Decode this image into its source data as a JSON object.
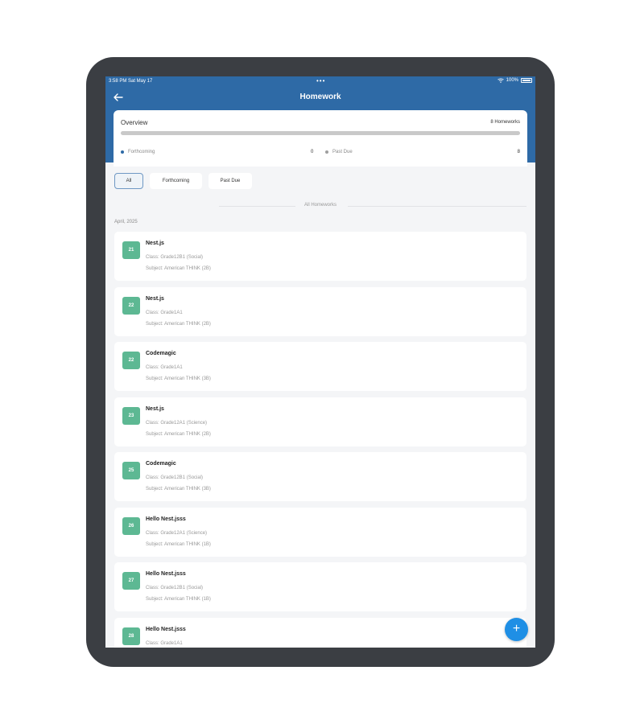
{
  "status_bar": {
    "time": "3:58 PM  Sat May 17",
    "dots": "•••",
    "battery": "100%"
  },
  "header": {
    "title": "Homework",
    "back_icon": "back-arrow-icon"
  },
  "overview": {
    "title": "Overview",
    "count": "8 Homeworks",
    "forthcoming_label": "Forthcoming",
    "forthcoming_value": "0",
    "past_due_label": "Past Due",
    "past_due_value": "8",
    "colors": {
      "forthcoming": "#2e6aa6",
      "past_due": "#9e9e9e"
    }
  },
  "filters": {
    "all": "All",
    "forthcoming": "Forthcoming",
    "past_due": "Past Due",
    "selected": "All"
  },
  "section_label": "All Homeworks",
  "month_label": "April, 2025",
  "homeworks": [
    {
      "day": "21",
      "title": "Nest.js",
      "class": "Class: Grade12B1 (Social)",
      "subject": "Subject: American THINK (2B)"
    },
    {
      "day": "22",
      "title": "Nest.js",
      "class": "Class: Grade1A1",
      "subject": "Subject: American THINK (2B)"
    },
    {
      "day": "22",
      "title": "Codemagic",
      "class": "Class: Grade1A1",
      "subject": "Subject: American THINK (3B)"
    },
    {
      "day": "23",
      "title": "Nest.js",
      "class": "Class: Grade12A1 (Science)",
      "subject": "Subject: American THINK (2B)"
    },
    {
      "day": "25",
      "title": "Codemagic",
      "class": "Class: Grade12B1 (Social)",
      "subject": "Subject: American THINK (3B)"
    },
    {
      "day": "26",
      "title": "Hello Nest.jsss",
      "class": "Class: Grade12A1 (Science)",
      "subject": "Subject: American THINK (1B)"
    },
    {
      "day": "27",
      "title": "Hello Nest.jsss",
      "class": "Class: Grade12B1 (Social)",
      "subject": "Subject: American THINK (1B)"
    },
    {
      "day": "28",
      "title": "Hello Nest.jsss",
      "class": "Class: Grade1A1",
      "subject": ""
    }
  ],
  "fab_label": "+",
  "colors": {
    "header": "#2e6aa6",
    "badge": "#5db893",
    "fab": "#1f8fe5"
  }
}
